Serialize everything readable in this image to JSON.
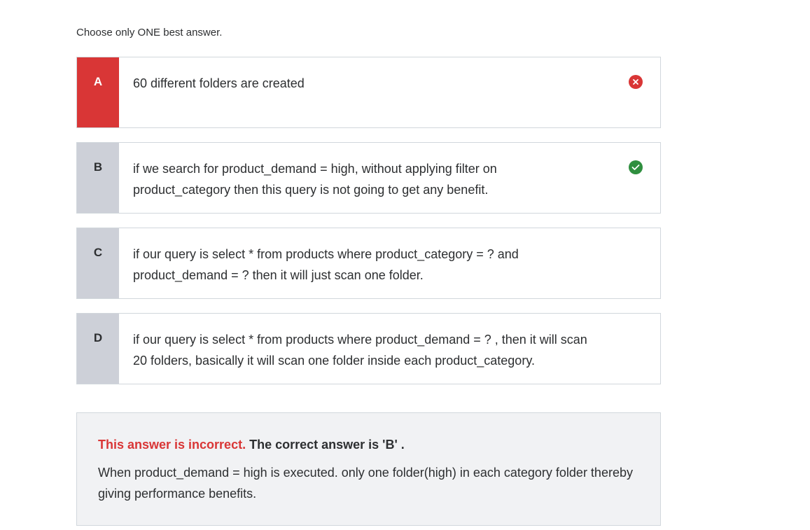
{
  "instruction": "Choose only ONE best answer.",
  "options": [
    {
      "letter": "A",
      "text": "60 different folders are created",
      "state": "selected-incorrect",
      "icon": "x-circle-icon"
    },
    {
      "letter": "B",
      "text": "if we search for product_demand = high, without applying filter on product_category then this query is not going to get any benefit.",
      "state": "correct",
      "icon": "check-circle-icon"
    },
    {
      "letter": "C",
      "text": "if our query is select * from products where product_category = ? and product_demand = ? then it will just scan one folder.",
      "state": "neutral"
    },
    {
      "letter": "D",
      "text": "if our query is select * from products where product_demand = ? , then it will scan 20 folders, basically it will scan one folder inside each product_category.",
      "state": "neutral"
    }
  ],
  "feedback": {
    "incorrect_label": "This answer is incorrect.",
    "correct_label": "The correct answer is 'B' .",
    "explanation": "When product_demand = high is executed. only one folder(high) in each category folder thereby giving performance benefits."
  },
  "colors": {
    "incorrect": "#d93636",
    "correct": "#2f8f3f",
    "letter_bg": "#cdd0d8",
    "feedback_bg": "#f1f2f4"
  }
}
